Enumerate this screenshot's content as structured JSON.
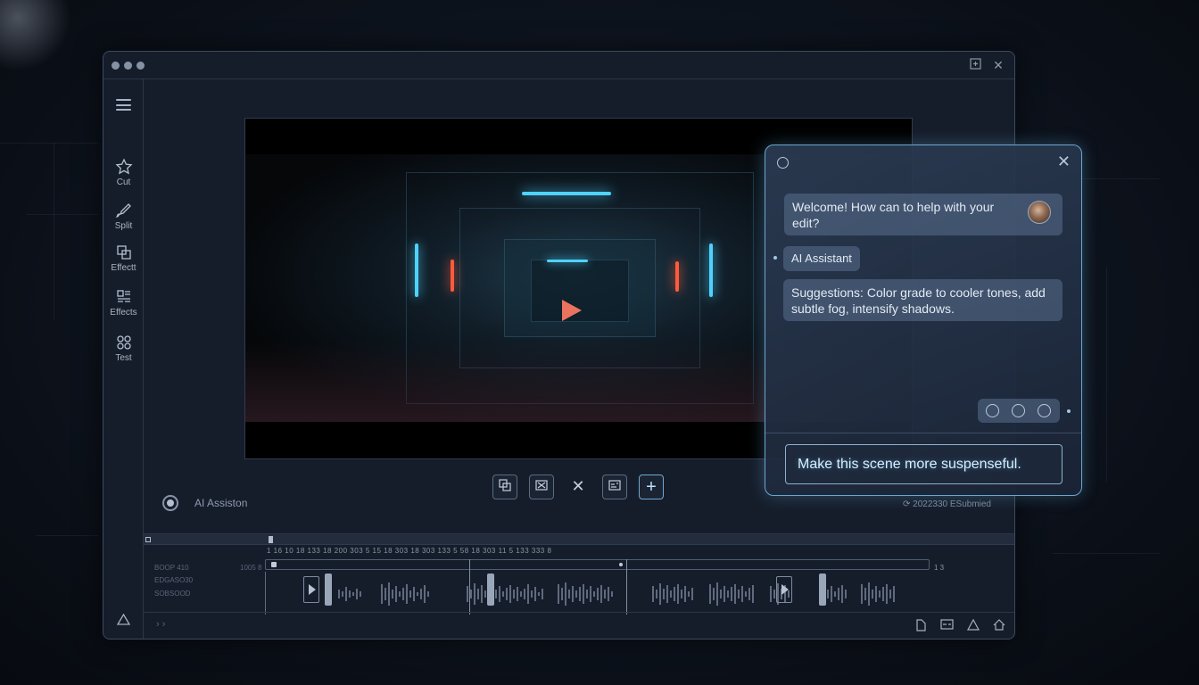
{
  "sidebar": {
    "tools": [
      {
        "label": "Cut",
        "icon": "star-icon"
      },
      {
        "label": "Split",
        "icon": "brush-icon"
      },
      {
        "label": "Effectt",
        "icon": "layers-icon"
      },
      {
        "label": "Effects",
        "icon": "grid-icon"
      },
      {
        "label": "Test",
        "icon": "circles-icon"
      }
    ]
  },
  "player": {
    "assistant_label": "AI Assiston",
    "status_text": "2022330 ESubmied"
  },
  "timeline": {
    "ticks": "1   16          10      18      133     18     200     303      5      15      18     303      18     303     133      5      58      18     303     11      5      133     333     8",
    "row_labels": [
      "BOOP  410",
      "EDGASO30",
      "SOBSOOD"
    ],
    "mini_label": "1005  8",
    "right_num": "1 3"
  },
  "assistant": {
    "welcome": "Welcome! How can to help with your edit?",
    "tag": "AI Assistant",
    "suggestion": "Suggestions: Color grade to cooler tones, add subtle fog, intensify shadows.",
    "input_value": "Make this scene more suspenseful."
  },
  "colors": {
    "accent": "#6aa7cf",
    "play_button": "#e9735e",
    "neon_blue": "#4fd2ff",
    "neon_red": "#ff5a3c"
  }
}
